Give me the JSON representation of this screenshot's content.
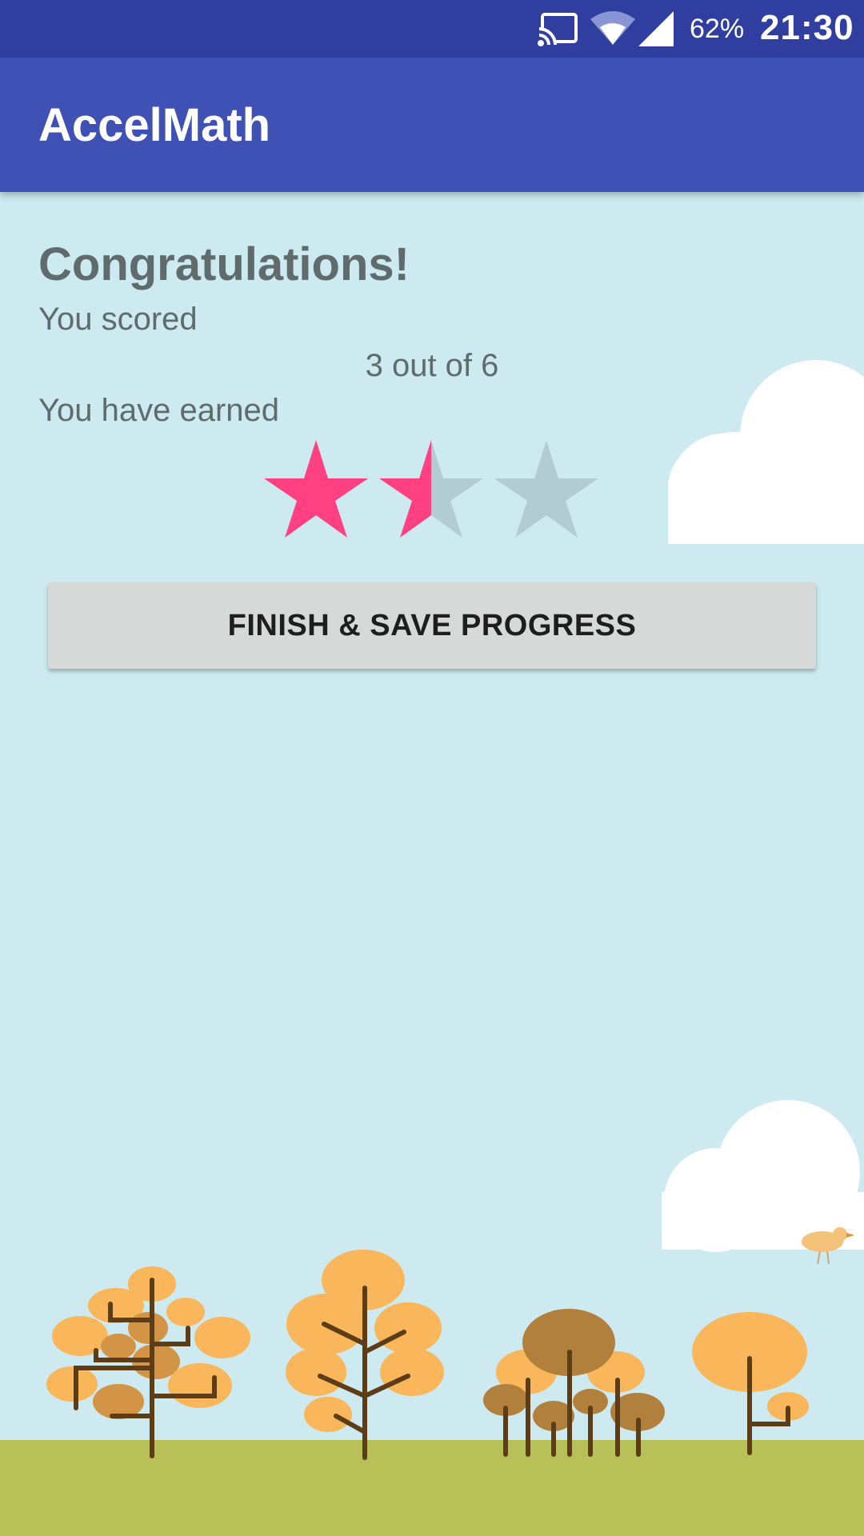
{
  "status_bar": {
    "battery": "62%",
    "time": "21:30",
    "icons": [
      "cast-icon",
      "wifi-icon",
      "signal-icon"
    ]
  },
  "app_bar": {
    "title": "AccelMath"
  },
  "results": {
    "heading": "Congratulations!",
    "scored_label": "You scored",
    "score": "3 out of 6",
    "earned_label": "You have earned",
    "rating": {
      "value": 1.5,
      "max": 3
    }
  },
  "actions": {
    "finish_label": "FINISH & SAVE PROGRESS"
  },
  "colors": {
    "status_bar": "#303f9f",
    "app_bar": "#3f51b5",
    "background": "#cdeaf0",
    "star_filled": "#ff4081",
    "star_empty": "#b2ccd1",
    "button": "#d7d8d8",
    "grass": "#b8c058"
  }
}
